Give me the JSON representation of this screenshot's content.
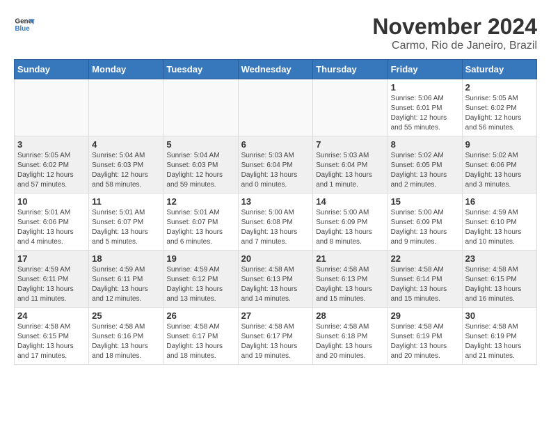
{
  "header": {
    "logo_line1": "General",
    "logo_line2": "Blue",
    "month_title": "November 2024",
    "location": "Carmo, Rio de Janeiro, Brazil"
  },
  "weekdays": [
    "Sunday",
    "Monday",
    "Tuesday",
    "Wednesday",
    "Thursday",
    "Friday",
    "Saturday"
  ],
  "weeks": [
    [
      {
        "day": "",
        "info": ""
      },
      {
        "day": "",
        "info": ""
      },
      {
        "day": "",
        "info": ""
      },
      {
        "day": "",
        "info": ""
      },
      {
        "day": "",
        "info": ""
      },
      {
        "day": "1",
        "info": "Sunrise: 5:06 AM\nSunset: 6:01 PM\nDaylight: 12 hours\nand 55 minutes."
      },
      {
        "day": "2",
        "info": "Sunrise: 5:05 AM\nSunset: 6:02 PM\nDaylight: 12 hours\nand 56 minutes."
      }
    ],
    [
      {
        "day": "3",
        "info": "Sunrise: 5:05 AM\nSunset: 6:02 PM\nDaylight: 12 hours\nand 57 minutes."
      },
      {
        "day": "4",
        "info": "Sunrise: 5:04 AM\nSunset: 6:03 PM\nDaylight: 12 hours\nand 58 minutes."
      },
      {
        "day": "5",
        "info": "Sunrise: 5:04 AM\nSunset: 6:03 PM\nDaylight: 12 hours\nand 59 minutes."
      },
      {
        "day": "6",
        "info": "Sunrise: 5:03 AM\nSunset: 6:04 PM\nDaylight: 13 hours\nand 0 minutes."
      },
      {
        "day": "7",
        "info": "Sunrise: 5:03 AM\nSunset: 6:04 PM\nDaylight: 13 hours\nand 1 minute."
      },
      {
        "day": "8",
        "info": "Sunrise: 5:02 AM\nSunset: 6:05 PM\nDaylight: 13 hours\nand 2 minutes."
      },
      {
        "day": "9",
        "info": "Sunrise: 5:02 AM\nSunset: 6:06 PM\nDaylight: 13 hours\nand 3 minutes."
      }
    ],
    [
      {
        "day": "10",
        "info": "Sunrise: 5:01 AM\nSunset: 6:06 PM\nDaylight: 13 hours\nand 4 minutes."
      },
      {
        "day": "11",
        "info": "Sunrise: 5:01 AM\nSunset: 6:07 PM\nDaylight: 13 hours\nand 5 minutes."
      },
      {
        "day": "12",
        "info": "Sunrise: 5:01 AM\nSunset: 6:07 PM\nDaylight: 13 hours\nand 6 minutes."
      },
      {
        "day": "13",
        "info": "Sunrise: 5:00 AM\nSunset: 6:08 PM\nDaylight: 13 hours\nand 7 minutes."
      },
      {
        "day": "14",
        "info": "Sunrise: 5:00 AM\nSunset: 6:09 PM\nDaylight: 13 hours\nand 8 minutes."
      },
      {
        "day": "15",
        "info": "Sunrise: 5:00 AM\nSunset: 6:09 PM\nDaylight: 13 hours\nand 9 minutes."
      },
      {
        "day": "16",
        "info": "Sunrise: 4:59 AM\nSunset: 6:10 PM\nDaylight: 13 hours\nand 10 minutes."
      }
    ],
    [
      {
        "day": "17",
        "info": "Sunrise: 4:59 AM\nSunset: 6:11 PM\nDaylight: 13 hours\nand 11 minutes."
      },
      {
        "day": "18",
        "info": "Sunrise: 4:59 AM\nSunset: 6:11 PM\nDaylight: 13 hours\nand 12 minutes."
      },
      {
        "day": "19",
        "info": "Sunrise: 4:59 AM\nSunset: 6:12 PM\nDaylight: 13 hours\nand 13 minutes."
      },
      {
        "day": "20",
        "info": "Sunrise: 4:58 AM\nSunset: 6:13 PM\nDaylight: 13 hours\nand 14 minutes."
      },
      {
        "day": "21",
        "info": "Sunrise: 4:58 AM\nSunset: 6:13 PM\nDaylight: 13 hours\nand 15 minutes."
      },
      {
        "day": "22",
        "info": "Sunrise: 4:58 AM\nSunset: 6:14 PM\nDaylight: 13 hours\nand 15 minutes."
      },
      {
        "day": "23",
        "info": "Sunrise: 4:58 AM\nSunset: 6:15 PM\nDaylight: 13 hours\nand 16 minutes."
      }
    ],
    [
      {
        "day": "24",
        "info": "Sunrise: 4:58 AM\nSunset: 6:15 PM\nDaylight: 13 hours\nand 17 minutes."
      },
      {
        "day": "25",
        "info": "Sunrise: 4:58 AM\nSunset: 6:16 PM\nDaylight: 13 hours\nand 18 minutes."
      },
      {
        "day": "26",
        "info": "Sunrise: 4:58 AM\nSunset: 6:17 PM\nDaylight: 13 hours\nand 18 minutes."
      },
      {
        "day": "27",
        "info": "Sunrise: 4:58 AM\nSunset: 6:17 PM\nDaylight: 13 hours\nand 19 minutes."
      },
      {
        "day": "28",
        "info": "Sunrise: 4:58 AM\nSunset: 6:18 PM\nDaylight: 13 hours\nand 20 minutes."
      },
      {
        "day": "29",
        "info": "Sunrise: 4:58 AM\nSunset: 6:19 PM\nDaylight: 13 hours\nand 20 minutes."
      },
      {
        "day": "30",
        "info": "Sunrise: 4:58 AM\nSunset: 6:19 PM\nDaylight: 13 hours\nand 21 minutes."
      }
    ]
  ]
}
